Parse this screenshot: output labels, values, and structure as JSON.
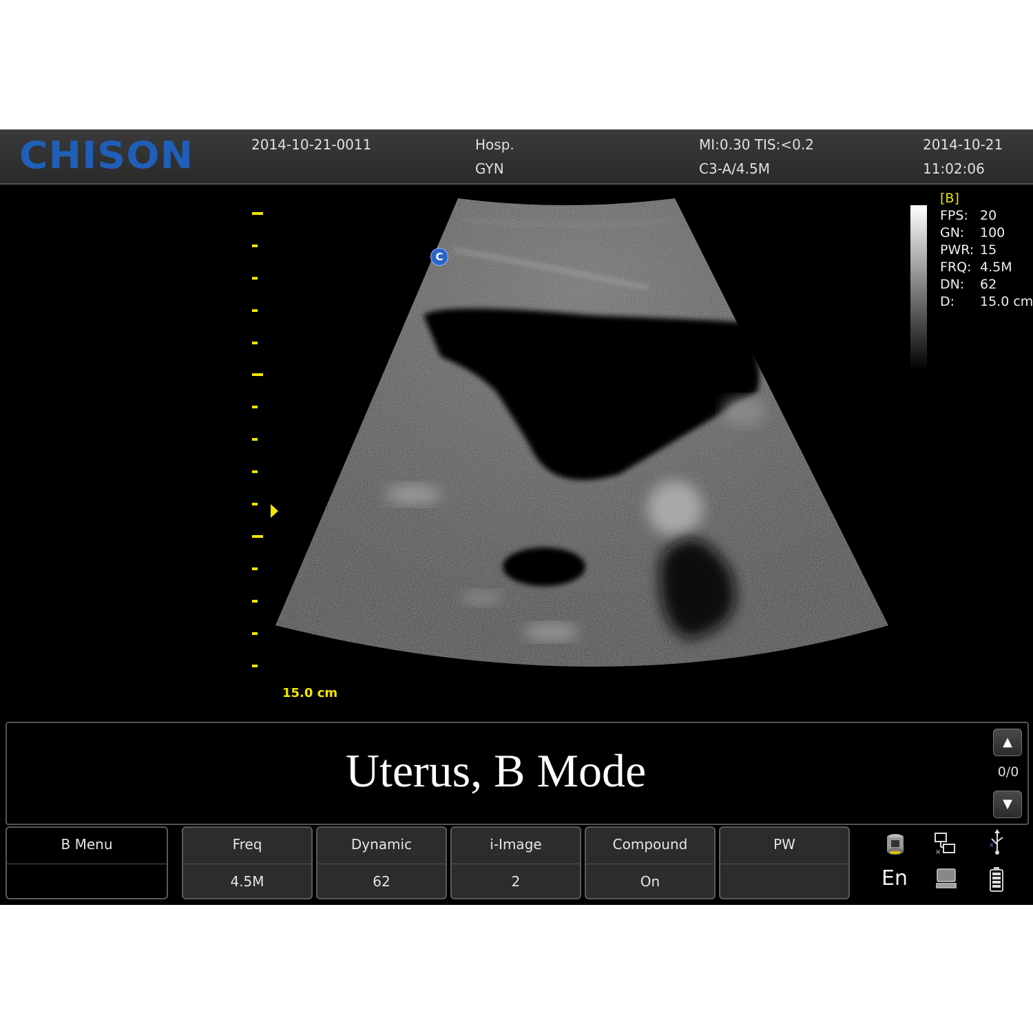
{
  "header": {
    "brand": "CHISON",
    "patient_id": "2014-10-21-0011",
    "hospital": "Hosp.",
    "exam_type": "GYN",
    "safety_index": "MI:0.30  TIS:<0.2",
    "probe": "C3-A/4.5M",
    "date": "2014-10-21",
    "time": "11:02:06"
  },
  "image": {
    "orientation_mark": "C",
    "depth_label": "15.0 cm",
    "mode_label": "[B]",
    "params": [
      {
        "key": "FPS:",
        "value": "20"
      },
      {
        "key": "GN:",
        "value": "100"
      },
      {
        "key": "PWR:",
        "value": "15"
      },
      {
        "key": "FRQ:",
        "value": "4.5M"
      },
      {
        "key": "DN:",
        "value": "62"
      },
      {
        "key": "D:",
        "value": "15.0 cm"
      }
    ],
    "accent_color": "#f2e600"
  },
  "comment": {
    "text": "Uterus, B Mode",
    "page": "0/0"
  },
  "softkeys": {
    "bmenu": {
      "label": "B Menu",
      "value": ""
    },
    "freq": {
      "label": "Freq",
      "value": "4.5M"
    },
    "dynamic": {
      "label": "Dynamic",
      "value": "62"
    },
    "iimage": {
      "label": "i-Image",
      "value": "2"
    },
    "compound": {
      "label": "Compound",
      "value": "On"
    },
    "pw": {
      "label": "PW",
      "value": ""
    }
  },
  "status": {
    "language": "En",
    "icons": [
      "printer-icon",
      "network-icon",
      "usb-icon",
      "keyboard-icon",
      "battery-icon"
    ]
  }
}
